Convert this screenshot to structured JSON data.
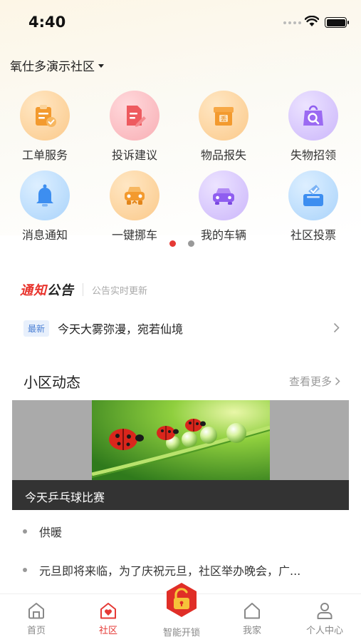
{
  "status_bar": {
    "time": "4:40"
  },
  "header": {
    "community": "氧仕多演示社区"
  },
  "services": [
    {
      "label": "工单服务",
      "icon": "clipboard-check-icon"
    },
    {
      "label": "投诉建议",
      "icon": "document-edit-icon"
    },
    {
      "label": "物品报失",
      "icon": "box-icon",
      "icon_text": "丢"
    },
    {
      "label": "失物招领",
      "icon": "bag-search-icon"
    },
    {
      "label": "消息通知",
      "icon": "bell-icon"
    },
    {
      "label": "一键挪车",
      "icon": "car-front-icon"
    },
    {
      "label": "我的车辆",
      "icon": "car-icon"
    },
    {
      "label": "社区投票",
      "icon": "ballot-box-icon"
    }
  ],
  "pager": {
    "total": 2,
    "active": 1
  },
  "notice": {
    "logo_red": "通知",
    "logo_dark": "公告",
    "subtitle": "公告实时更新",
    "badge": "最新",
    "text": "今天大雾弥漫，宛若仙境"
  },
  "community_news": {
    "title": "小区动态",
    "see_more": "查看更多",
    "banner_caption": "今天乒乓球比赛",
    "items": [
      "供暖",
      "元旦即将来临，为了庆祝元旦，社区举办晚会，广..."
    ]
  },
  "tab_bar": {
    "tabs": [
      {
        "label": "首页"
      },
      {
        "label": "社区"
      },
      {
        "label": "智能开锁"
      },
      {
        "label": "我家"
      },
      {
        "label": "个人中心"
      }
    ],
    "active": "社区"
  },
  "colors": {
    "accent_red": "#e53935",
    "inactive_gray": "#888888"
  }
}
